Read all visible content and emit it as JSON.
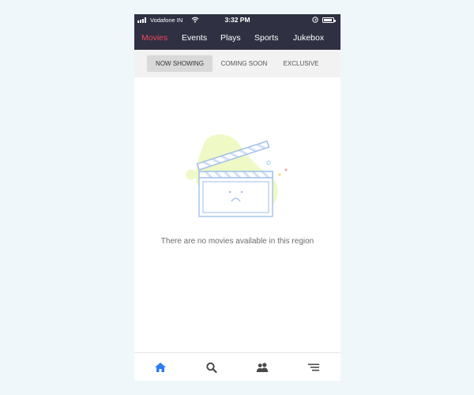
{
  "status_bar": {
    "carrier": "Vodafone IN",
    "time": "3:32 PM"
  },
  "nav": {
    "items": [
      {
        "label": "Movies",
        "active": true
      },
      {
        "label": "Events",
        "active": false
      },
      {
        "label": "Plays",
        "active": false
      },
      {
        "label": "Sports",
        "active": false
      },
      {
        "label": "Jukebox",
        "active": false
      }
    ]
  },
  "subtabs": [
    {
      "label": "NOW SHOWING",
      "active": true
    },
    {
      "label": "COMING SOON",
      "active": false
    },
    {
      "label": "EXCLUSIVE",
      "active": false
    }
  ],
  "empty_state": {
    "illustration": "clapperboard-sad-icon",
    "message": "There are no movies available in this region"
  },
  "tabbar": {
    "items": [
      {
        "icon": "home-icon",
        "active": true
      },
      {
        "icon": "search-icon",
        "active": false
      },
      {
        "icon": "people-icon",
        "active": false
      },
      {
        "icon": "menu-icon",
        "active": false
      }
    ]
  },
  "colors": {
    "nav_bg": "#2f3042",
    "accent": "#f0455f",
    "tab_active": "#2e7cf6",
    "tab_inactive": "#4a4a4a",
    "blob": "#eef9c5",
    "illustration_stroke": "#9dbde9"
  }
}
